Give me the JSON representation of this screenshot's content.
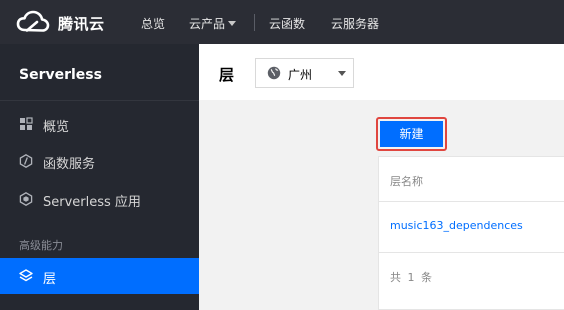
{
  "topnav": {
    "brand": "腾讯云",
    "items": [
      {
        "label": "总览"
      },
      {
        "label": "云产品"
      },
      {
        "label": "云函数"
      },
      {
        "label": "云服务器"
      }
    ]
  },
  "sidebar": {
    "title": "Serverless",
    "items": [
      {
        "label": "概览",
        "icon": "grid-icon"
      },
      {
        "label": "函数服务",
        "icon": "function-icon"
      },
      {
        "label": "Serverless 应用",
        "icon": "app-icon"
      }
    ],
    "section_label": "高级能力",
    "active_item": {
      "label": "层",
      "icon": "layers-icon"
    }
  },
  "header": {
    "title": "层",
    "region": "广州"
  },
  "main": {
    "new_button": "新建",
    "table": {
      "column": "层名称",
      "rows": [
        {
          "name": "music163_dependences"
        }
      ],
      "footer": "共 1 条"
    }
  },
  "colors": {
    "topbar": "#2b2d35",
    "sidebar": "#252830",
    "accent": "#006eff",
    "highlight_border": "#e0463f"
  }
}
